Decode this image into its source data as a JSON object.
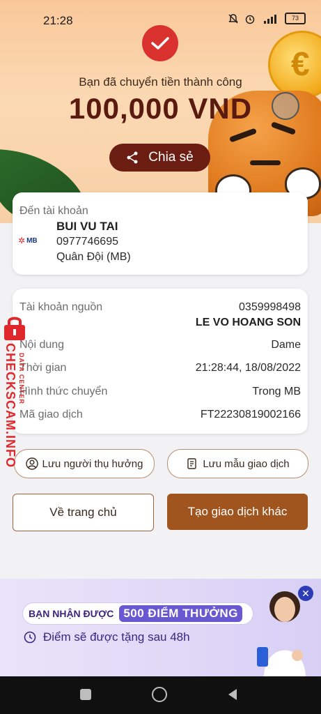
{
  "status_bar": {
    "time": "21:28",
    "battery": "73"
  },
  "hero": {
    "message": "Bạn đã chuyển tiền thành công",
    "amount": "100,000 VND",
    "share_label": "Chia sẻ"
  },
  "recipient": {
    "label": "Đến tài khoản",
    "name": "BUI VU TAI",
    "account": "0977746695",
    "bank": "Quân Đội (MB)",
    "bank_logo": "MB"
  },
  "details": {
    "source_label": "Tài khoản nguồn",
    "source_account": "0359998498",
    "source_name": "LE VO HOANG SON",
    "content_label": "Nội dung",
    "content_value": "Dame",
    "time_label": "Thời gian",
    "time_value": "21:28:44, 18/08/2022",
    "method_label": "Hình thức chuyển",
    "method_value": "Trong MB",
    "code_label": "Mã giao dịch",
    "code_value": "FT22230819002166"
  },
  "actions": {
    "save_beneficiary": "Lưu người thụ hưởng",
    "save_template": "Lưu mẫu giao dịch",
    "home": "Về trang chủ",
    "new_transaction": "Tạo giao dịch khác"
  },
  "banner": {
    "receive_text": "BẠN NHẬN ĐƯỢC",
    "points_text": "500 ĐIỂM THƯỞNG",
    "note": "Điểm sẽ được tặng sau 48h"
  },
  "watermark": {
    "main": "CHECKSCAM.INFO",
    "sub": "DATA CENTER"
  },
  "colors": {
    "brand_dark": "#6b1d12",
    "accent": "#a0541e",
    "success": "#d9322e",
    "banner_text": "#3a2580"
  }
}
